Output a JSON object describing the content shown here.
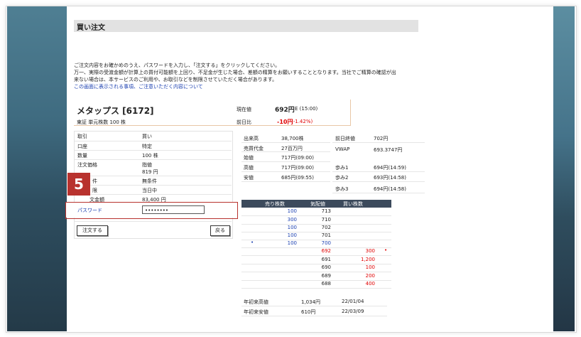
{
  "page": {
    "title": "買い注文",
    "message_lines": [
      "ご注文内容をお確かめのうえ、パスワードを入力し、「注文する」をクリックしてください。",
      "万一、実際の受渡金額が計算上の買付可能額を上回り、不足金が生じた場合、差額の精算をお願いすることとなります。当社でご精算の確認が出",
      "来ない場合は、本サービスのご利用や、お取引などを制限させていただく場合があります。"
    ],
    "notice_link": "この画面に表示される事項、ご注意いただく内容について"
  },
  "stock": {
    "name": "メタップス [6172]",
    "market_line": "東証 単元株数 100 株",
    "price_label": "現在値",
    "price_value": "692円",
    "price_suffix": "E (15:00)",
    "change_label": "前日比",
    "change_value": "-10円",
    "change_pct": "(-1.42%)"
  },
  "order": {
    "rows": [
      {
        "label": "取引",
        "value": "買い"
      },
      {
        "label": "口座",
        "value": "特定"
      },
      {
        "label": "数量",
        "value": "100 株"
      },
      {
        "label": "注文価格",
        "value": "指値",
        "value2": "819 円"
      },
      {
        "label": "件",
        "value": "無条件"
      },
      {
        "label": "限",
        "value": "当日中"
      },
      {
        "label": "文金額",
        "value": "83,400 円"
      }
    ],
    "password_label": "パスワード",
    "password_value": "••••••••",
    "submit_label": "注文する",
    "back_label": "戻る"
  },
  "step_badge": "5",
  "quote": {
    "left": [
      {
        "label": "出来高",
        "value": "38,700株"
      },
      {
        "label": "売買代金",
        "value": "27百万円"
      },
      {
        "label": "始値",
        "value": "717円(09:00)"
      },
      {
        "label": "高値",
        "value": "717円(09:00)"
      },
      {
        "label": "安値",
        "value": "685円(09:55)"
      }
    ],
    "right": [
      {
        "label": "前日終値",
        "value": "702円"
      },
      {
        "label": "VWAP",
        "value": "693.3747円"
      },
      {
        "label": "",
        "value": ""
      },
      {
        "label": "歩み1",
        "value": "694円(14:59)"
      },
      {
        "label": "歩み2",
        "value": "693円(14:58)"
      },
      {
        "label": "歩み3",
        "value": "694円(14:58)"
      }
    ]
  },
  "board": {
    "headers": [
      "売り株数",
      "気配値",
      "買い株数"
    ],
    "rows": [
      {
        "mark": "",
        "sell": "100",
        "price": "713",
        "buy": "",
        "bmark": ""
      },
      {
        "mark": "",
        "sell": "300",
        "price": "710",
        "buy": "",
        "bmark": ""
      },
      {
        "mark": "",
        "sell": "100",
        "price": "702",
        "buy": "",
        "bmark": ""
      },
      {
        "mark": "",
        "sell": "100",
        "price": "701",
        "buy": "",
        "bmark": ""
      },
      {
        "mark": "•",
        "sell": "100",
        "price": "700",
        "buy": "",
        "bmark": ""
      },
      {
        "mark": "",
        "sell": "",
        "price": "692",
        "buy": "300",
        "bmark": "•"
      },
      {
        "mark": "",
        "sell": "",
        "price": "691",
        "buy": "1,200",
        "bmark": ""
      },
      {
        "mark": "",
        "sell": "",
        "price": "690",
        "buy": "100",
        "bmark": ""
      },
      {
        "mark": "",
        "sell": "",
        "price": "689",
        "buy": "200",
        "bmark": ""
      },
      {
        "mark": "",
        "sell": "",
        "price": "688",
        "buy": "400",
        "bmark": ""
      }
    ]
  },
  "yearly": [
    {
      "label": "年初来高値",
      "value": "1,034円",
      "date": "22/01/04"
    },
    {
      "label": "年初来安値",
      "value": "610円",
      "date": "22/03/09"
    }
  ]
}
